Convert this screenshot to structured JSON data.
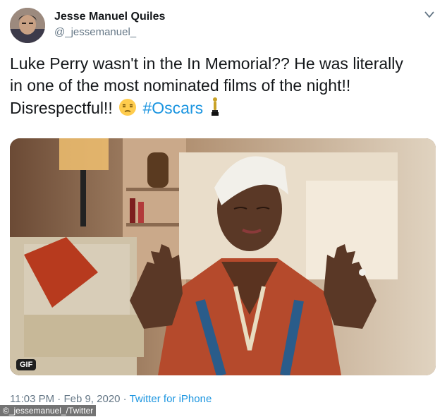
{
  "author": {
    "name": "Jesse Manuel Quiles",
    "handle": "@_jessemanuel_"
  },
  "tweet": {
    "line1": "Luke Perry wasn't in the In Memorial?? He was literally",
    "line2": "in one of the most nominated films of the night!!",
    "line3_prefix": "Disrespectful!!",
    "hashtag": "#Oscars"
  },
  "media": {
    "badge": "GIF"
  },
  "meta": {
    "time": "11:03 PM",
    "date": "Feb 9, 2020",
    "separator": "·",
    "source": "Twitter for iPhone"
  },
  "credit": "©_jessemanuel_/Twitter",
  "icons": {
    "menu": "chevron-down-icon",
    "emoji1": "unamused-face-emoji",
    "emoji2": "trophy-statuette-emoji"
  }
}
